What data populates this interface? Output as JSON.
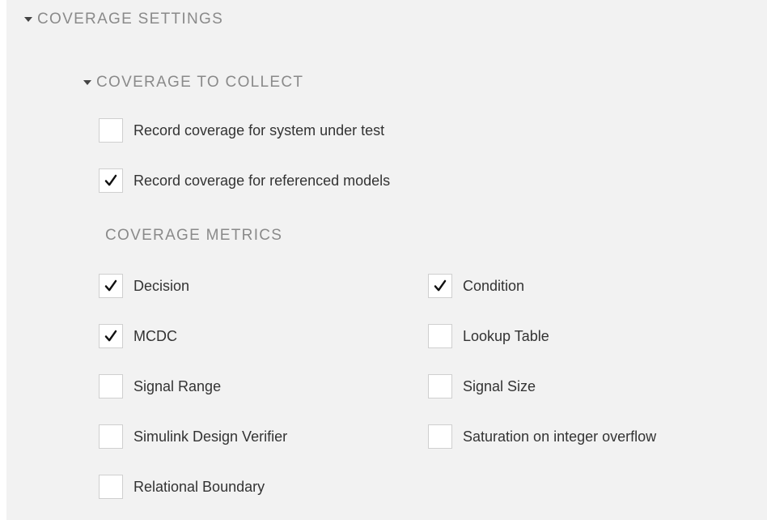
{
  "coverage_settings": {
    "title": "COVERAGE SETTINGS",
    "coverage_to_collect": {
      "title": "COVERAGE TO COLLECT",
      "record_system": {
        "label": "Record coverage for system under test",
        "checked": false
      },
      "record_referenced": {
        "label": "Record coverage for referenced models",
        "checked": true
      }
    },
    "coverage_metrics": {
      "title": "COVERAGE METRICS",
      "decision": {
        "label": "Decision",
        "checked": true
      },
      "condition": {
        "label": "Condition",
        "checked": true
      },
      "mcdc": {
        "label": "MCDC",
        "checked": true
      },
      "lookup_table": {
        "label": "Lookup Table",
        "checked": false
      },
      "signal_range": {
        "label": "Signal Range",
        "checked": false
      },
      "signal_size": {
        "label": "Signal Size",
        "checked": false
      },
      "simulink_design_verifier": {
        "label": "Simulink Design Verifier",
        "checked": false
      },
      "saturation": {
        "label": "Saturation on integer overflow",
        "checked": false
      },
      "relational_boundary": {
        "label": "Relational Boundary",
        "checked": false
      }
    }
  }
}
